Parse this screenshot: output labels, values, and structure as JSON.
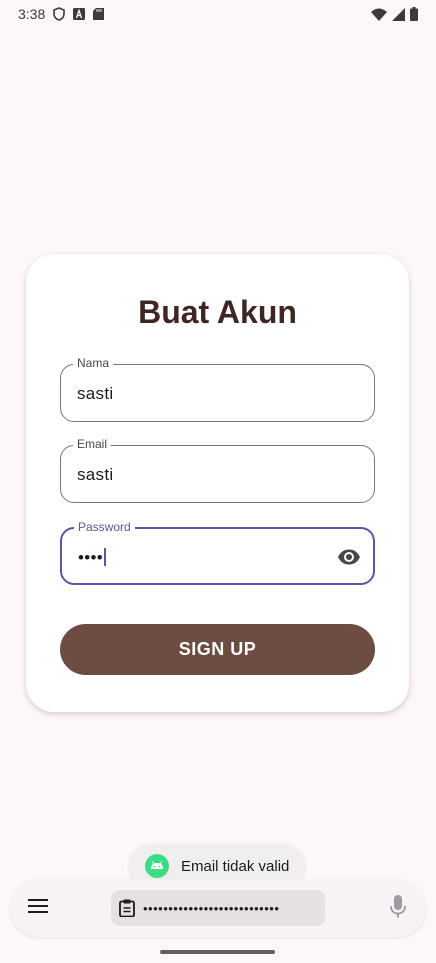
{
  "status_bar": {
    "time": "3:38",
    "icons_left": [
      "shield-icon",
      "a-badge-icon",
      "sd-card-icon"
    ],
    "icons_right": [
      "wifi-icon",
      "signal-icon",
      "battery-icon"
    ]
  },
  "form": {
    "title": "Buat Akun",
    "name": {
      "label": "Nama",
      "value": "sasti"
    },
    "email": {
      "label": "Email",
      "value": "sasti"
    },
    "password": {
      "label": "Password",
      "value": "••••"
    },
    "submit_label": "SIGN UP"
  },
  "toast": {
    "message": "Email tidak valid"
  },
  "keyboard": {
    "clipboard_text": "•••••••••••••••••••••••••••"
  },
  "colors": {
    "background": "#fdf7fc",
    "title": "#3e2723",
    "button": "#6d4c41",
    "focus": "#6750a4"
  }
}
